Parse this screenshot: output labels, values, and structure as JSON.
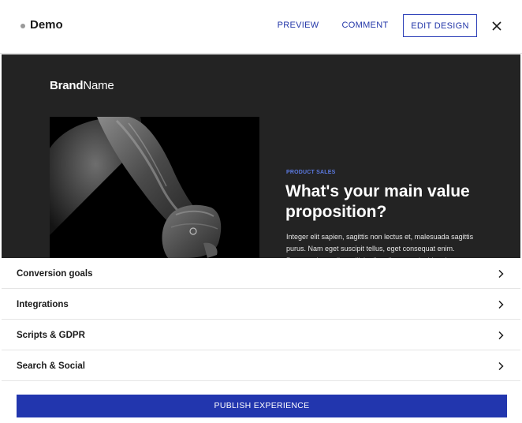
{
  "header": {
    "title": "Demo",
    "preview_label": "PREVIEW",
    "comment_label": "COMMENT",
    "edit_design_label": "EDIT DESIGN",
    "close_icon": "close-icon"
  },
  "preview": {
    "brand_bold": "Brand",
    "brand_regular": "Name",
    "eyebrow": "PRODUCT SALES",
    "headline": "What's your main value proposition?",
    "body": "Integer elit sapien, sagittis non lectus et, malesuada sagittis purus. Nam eget suscipit tellus, eget consequat enim. Praesent imperdiet sollicitudin tellus, non tincidunt ipsum"
  },
  "settings": {
    "items": [
      {
        "label": "Conversion goals",
        "icon": "chevron-right-icon"
      },
      {
        "label": "Integrations",
        "icon": "chevron-right-icon"
      },
      {
        "label": "Scripts & GDPR",
        "icon": "chevron-right-icon"
      },
      {
        "label": "Search & Social",
        "icon": "chevron-right-icon"
      }
    ]
  },
  "publish_label": "PUBLISH EXPERIENCE",
  "colors": {
    "accent": "#2236ae",
    "preview_bg": "#232323",
    "eyebrow": "#5b79e0"
  }
}
